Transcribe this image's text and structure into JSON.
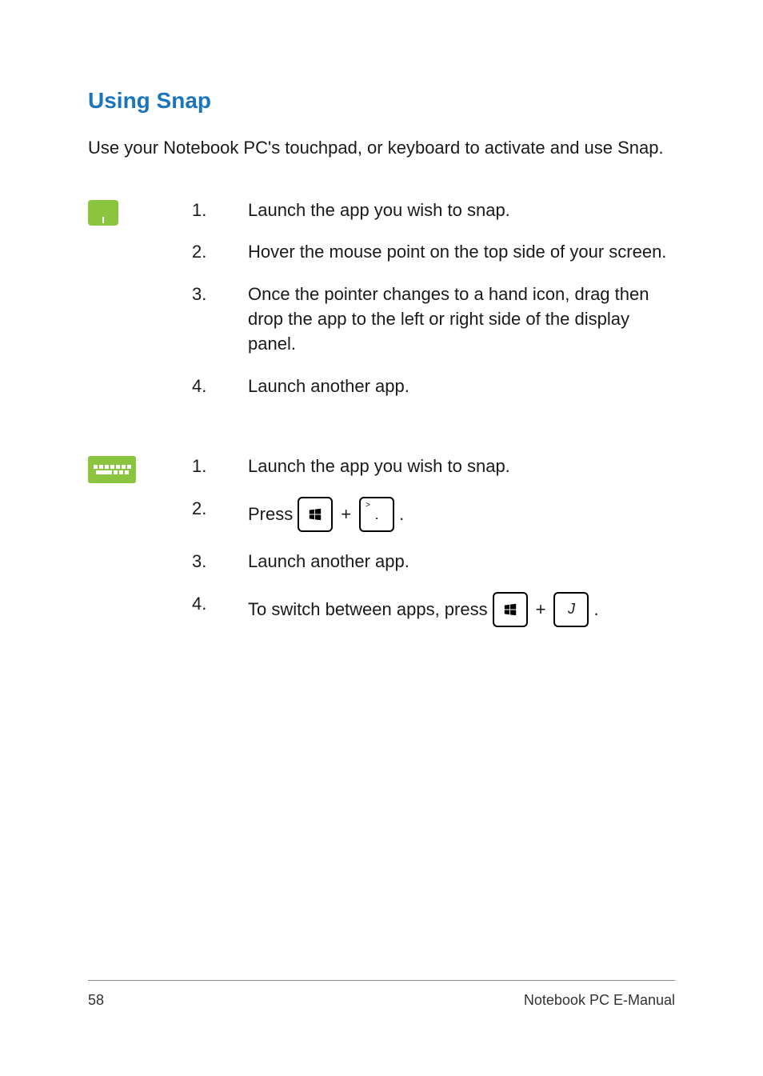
{
  "title": "Using Snap",
  "intro": "Use your Notebook PC's touchpad, or keyboard to activate and use Snap.",
  "touchpad_steps": [
    {
      "num": "1.",
      "text": "Launch the app you wish to snap."
    },
    {
      "num": "2.",
      "text": "Hover the mouse point on the top side of your screen."
    },
    {
      "num": "3.",
      "text": "Once the pointer changes to a hand icon, drag then drop the app to the left or right side of the display panel."
    },
    {
      "num": "4.",
      "text": "Launch another app."
    }
  ],
  "keyboard_steps": {
    "s1": {
      "num": "1.",
      "text": "Launch the app you wish to snap."
    },
    "s2": {
      "num": "2.",
      "prefix": "Press ",
      "period_super": ">",
      "period_glyph": "."
    },
    "s3": {
      "num": "3.",
      "text": "Launch another app."
    },
    "s4": {
      "num": "4.",
      "prefix": "To switch between apps, press ",
      "j_label": "J"
    }
  },
  "plus": "+",
  "dot": ".",
  "footer": {
    "page": "58",
    "title": "Notebook PC E-Manual"
  }
}
